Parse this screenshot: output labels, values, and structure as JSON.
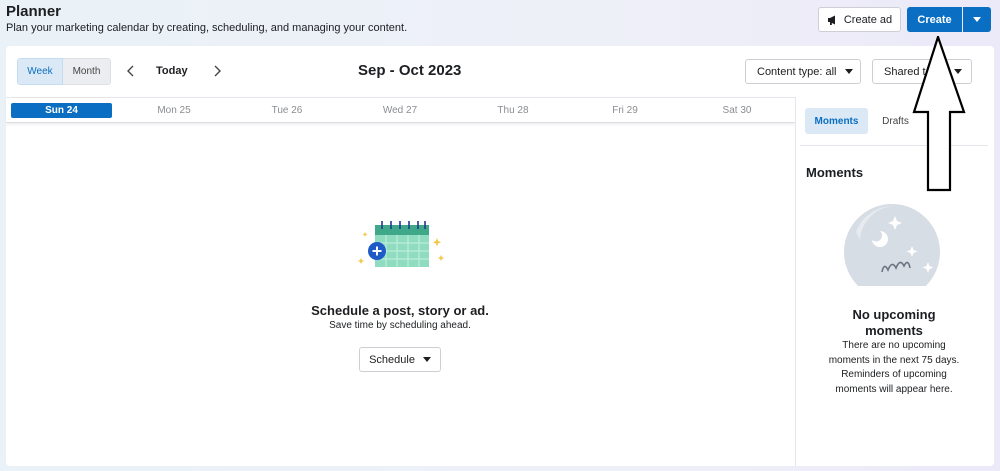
{
  "header": {
    "title": "Planner",
    "subtitle": "Plan your marketing calendar by creating, scheduling, and managing your content.",
    "create_ad_label": "Create ad",
    "create_label": "Create"
  },
  "toolbar": {
    "week_label": "Week",
    "month_label": "Month",
    "today_label": "Today",
    "date_range": "Sep - Oct 2023",
    "content_type_label": "Content type: all",
    "shared_label": "Shared to all"
  },
  "days": [
    {
      "label": "Sun 24",
      "active": true
    },
    {
      "label": "Mon 25",
      "active": false
    },
    {
      "label": "Tue 26",
      "active": false
    },
    {
      "label": "Wed 27",
      "active": false
    },
    {
      "label": "Thu 28",
      "active": false
    },
    {
      "label": "Fri 29",
      "active": false
    },
    {
      "label": "Sat 30",
      "active": false
    }
  ],
  "empty_state": {
    "title": "Schedule a post, story or ad.",
    "subtitle": "Save time by scheduling ahead.",
    "schedule_label": "Schedule"
  },
  "sidebar": {
    "tab_moments": "Moments",
    "tab_drafts": "Drafts",
    "section_title": "Moments",
    "no_title_1": "No upcoming",
    "no_title_2": "moments",
    "no_lines": [
      "There are no upcoming",
      "moments in the next 75 days.",
      "Reminders of upcoming",
      "moments will appear here."
    ]
  },
  "colors": {
    "accent": "#0a6fc2",
    "accent_light": "#dbe9f6",
    "calendar_green": "#7fd6b5"
  },
  "icons": {
    "create_ad": "megaphone-icon",
    "prev": "chevron-left-icon",
    "next": "chevron-right-icon",
    "calendar": "calendar-add-icon",
    "moments": "crystal-ball-icon"
  }
}
